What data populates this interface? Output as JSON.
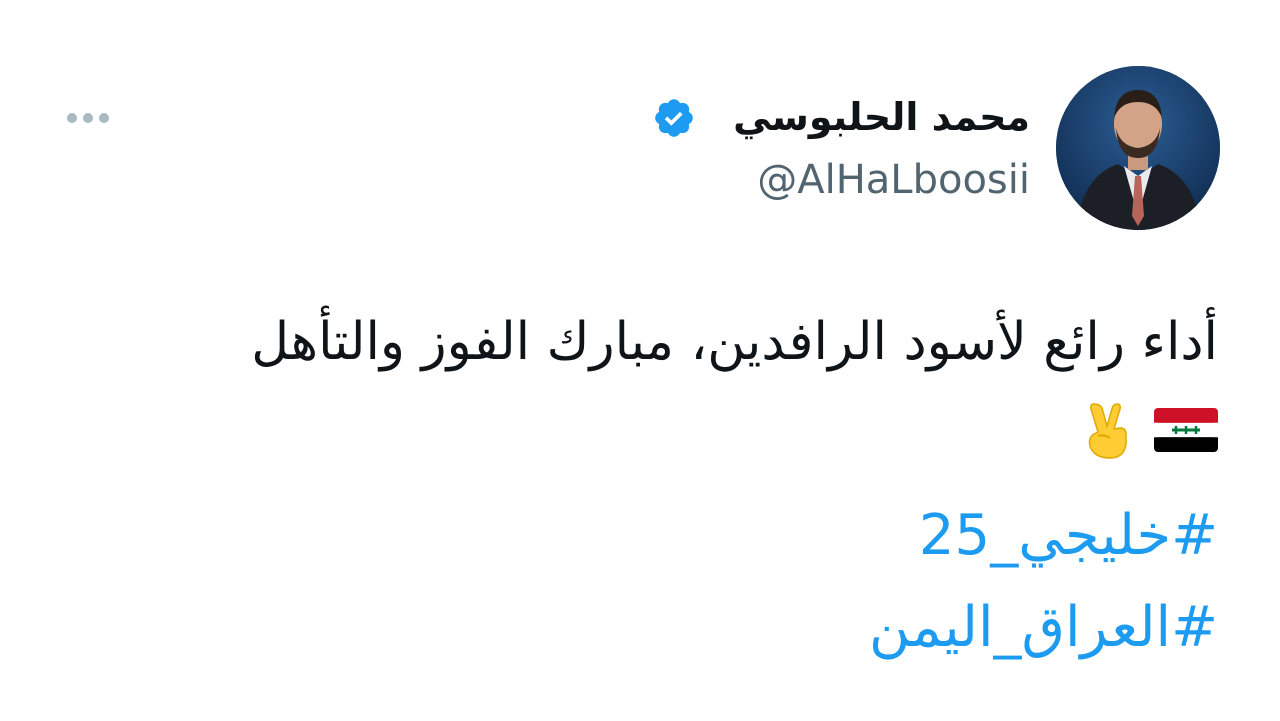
{
  "author": {
    "display_name": "محمد الحلبوسي",
    "handle": "@AlHaLboosii",
    "verified": true
  },
  "tweet": {
    "text": "أداء رائع لأسود الرافدين، مبارك الفوز والتأهل",
    "emojis": [
      "iraq-flag-icon",
      "victory-hand-icon"
    ],
    "hashtags": [
      "#خليجي_25",
      "#العراق_اليمن"
    ]
  },
  "colors": {
    "hashtag": "#1d9bf0",
    "verified_badge": "#1d9bf0",
    "text": "#0f1419",
    "handle": "#536471"
  }
}
